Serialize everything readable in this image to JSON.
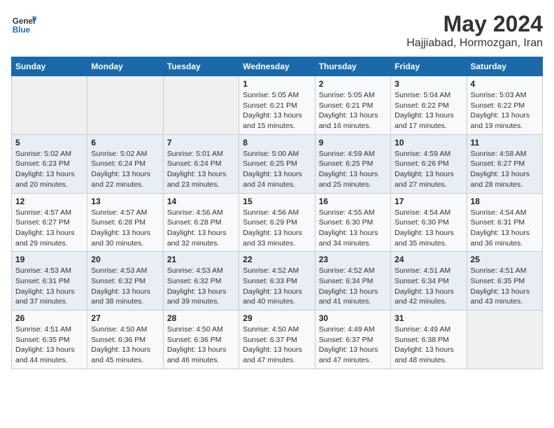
{
  "logo": {
    "line1": "General",
    "line2": "Blue"
  },
  "title": "May 2024",
  "subtitle": "Hajjiabad, Hormozgan, Iran",
  "days_of_week": [
    "Sunday",
    "Monday",
    "Tuesday",
    "Wednesday",
    "Thursday",
    "Friday",
    "Saturday"
  ],
  "weeks": [
    [
      {
        "num": "",
        "info": ""
      },
      {
        "num": "",
        "info": ""
      },
      {
        "num": "",
        "info": ""
      },
      {
        "num": "1",
        "info": "Sunrise: 5:05 AM\nSunset: 6:21 PM\nDaylight: 13 hours and 15 minutes."
      },
      {
        "num": "2",
        "info": "Sunrise: 5:05 AM\nSunset: 6:21 PM\nDaylight: 13 hours and 16 minutes."
      },
      {
        "num": "3",
        "info": "Sunrise: 5:04 AM\nSunset: 6:22 PM\nDaylight: 13 hours and 17 minutes."
      },
      {
        "num": "4",
        "info": "Sunrise: 5:03 AM\nSunset: 6:22 PM\nDaylight: 13 hours and 19 minutes."
      }
    ],
    [
      {
        "num": "5",
        "info": "Sunrise: 5:02 AM\nSunset: 6:23 PM\nDaylight: 13 hours and 20 minutes."
      },
      {
        "num": "6",
        "info": "Sunrise: 5:02 AM\nSunset: 6:24 PM\nDaylight: 13 hours and 22 minutes."
      },
      {
        "num": "7",
        "info": "Sunrise: 5:01 AM\nSunset: 6:24 PM\nDaylight: 13 hours and 23 minutes."
      },
      {
        "num": "8",
        "info": "Sunrise: 5:00 AM\nSunset: 6:25 PM\nDaylight: 13 hours and 24 minutes."
      },
      {
        "num": "9",
        "info": "Sunrise: 4:59 AM\nSunset: 6:25 PM\nDaylight: 13 hours and 25 minutes."
      },
      {
        "num": "10",
        "info": "Sunrise: 4:59 AM\nSunset: 6:26 PM\nDaylight: 13 hours and 27 minutes."
      },
      {
        "num": "11",
        "info": "Sunrise: 4:58 AM\nSunset: 6:27 PM\nDaylight: 13 hours and 28 minutes."
      }
    ],
    [
      {
        "num": "12",
        "info": "Sunrise: 4:57 AM\nSunset: 6:27 PM\nDaylight: 13 hours and 29 minutes."
      },
      {
        "num": "13",
        "info": "Sunrise: 4:57 AM\nSunset: 6:28 PM\nDaylight: 13 hours and 30 minutes."
      },
      {
        "num": "14",
        "info": "Sunrise: 4:56 AM\nSunset: 6:28 PM\nDaylight: 13 hours and 32 minutes."
      },
      {
        "num": "15",
        "info": "Sunrise: 4:56 AM\nSunset: 6:29 PM\nDaylight: 13 hours and 33 minutes."
      },
      {
        "num": "16",
        "info": "Sunrise: 4:55 AM\nSunset: 6:30 PM\nDaylight: 13 hours and 34 minutes."
      },
      {
        "num": "17",
        "info": "Sunrise: 4:54 AM\nSunset: 6:30 PM\nDaylight: 13 hours and 35 minutes."
      },
      {
        "num": "18",
        "info": "Sunrise: 4:54 AM\nSunset: 6:31 PM\nDaylight: 13 hours and 36 minutes."
      }
    ],
    [
      {
        "num": "19",
        "info": "Sunrise: 4:53 AM\nSunset: 6:31 PM\nDaylight: 13 hours and 37 minutes."
      },
      {
        "num": "20",
        "info": "Sunrise: 4:53 AM\nSunset: 6:32 PM\nDaylight: 13 hours and 38 minutes."
      },
      {
        "num": "21",
        "info": "Sunrise: 4:53 AM\nSunset: 6:32 PM\nDaylight: 13 hours and 39 minutes."
      },
      {
        "num": "22",
        "info": "Sunrise: 4:52 AM\nSunset: 6:33 PM\nDaylight: 13 hours and 40 minutes."
      },
      {
        "num": "23",
        "info": "Sunrise: 4:52 AM\nSunset: 6:34 PM\nDaylight: 13 hours and 41 minutes."
      },
      {
        "num": "24",
        "info": "Sunrise: 4:51 AM\nSunset: 6:34 PM\nDaylight: 13 hours and 42 minutes."
      },
      {
        "num": "25",
        "info": "Sunrise: 4:51 AM\nSunset: 6:35 PM\nDaylight: 13 hours and 43 minutes."
      }
    ],
    [
      {
        "num": "26",
        "info": "Sunrise: 4:51 AM\nSunset: 6:35 PM\nDaylight: 13 hours and 44 minutes."
      },
      {
        "num": "27",
        "info": "Sunrise: 4:50 AM\nSunset: 6:36 PM\nDaylight: 13 hours and 45 minutes."
      },
      {
        "num": "28",
        "info": "Sunrise: 4:50 AM\nSunset: 6:36 PM\nDaylight: 13 hours and 46 minutes."
      },
      {
        "num": "29",
        "info": "Sunrise: 4:50 AM\nSunset: 6:37 PM\nDaylight: 13 hours and 47 minutes."
      },
      {
        "num": "30",
        "info": "Sunrise: 4:49 AM\nSunset: 6:37 PM\nDaylight: 13 hours and 47 minutes."
      },
      {
        "num": "31",
        "info": "Sunrise: 4:49 AM\nSunset: 6:38 PM\nDaylight: 13 hours and 48 minutes."
      },
      {
        "num": "",
        "info": ""
      }
    ]
  ]
}
